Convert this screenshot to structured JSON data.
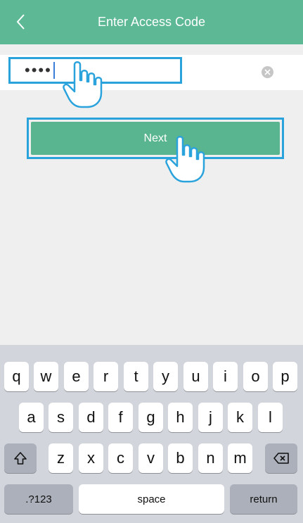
{
  "navbar": {
    "title": "Enter Access Code",
    "back_icon": "chevron-left-icon"
  },
  "code_input": {
    "value": "••••",
    "clear_icon": "clear-x-icon"
  },
  "next_button": {
    "label": "Next"
  },
  "keyboard": {
    "row1": [
      "q",
      "w",
      "e",
      "r",
      "t",
      "y",
      "u",
      "i",
      "o",
      "p"
    ],
    "row2": [
      "a",
      "s",
      "d",
      "f",
      "g",
      "h",
      "j",
      "k",
      "l"
    ],
    "row3": [
      "z",
      "x",
      "c",
      "v",
      "b",
      "n",
      "m"
    ],
    "shift_icon": "shift-icon",
    "delete_icon": "backspace-icon",
    "numbers_label": ".?123",
    "space_label": "space",
    "return_label": "return"
  },
  "colors": {
    "accent": "#5cb895",
    "highlight": "#2aa2dc",
    "keyboard_bg": "#d2d5db"
  }
}
